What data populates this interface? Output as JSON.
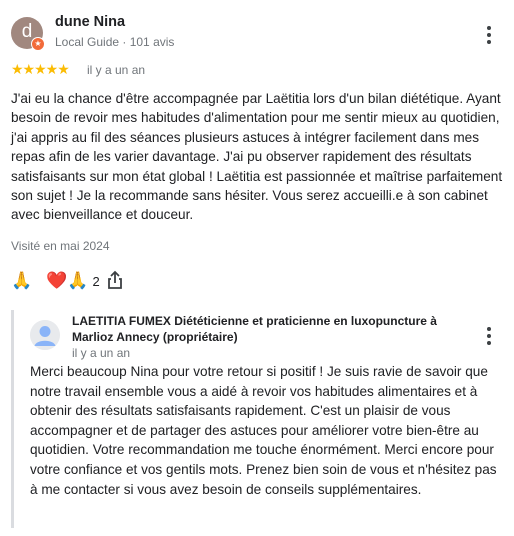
{
  "review": {
    "avatar_letter": "d",
    "author": "dune Nina",
    "meta": "Local Guide · 101 avis",
    "stars": "★★★★★",
    "rating": 5,
    "date": "il y a un an",
    "text": "J'ai eu la chance d'être accompagnée par Laëtitia lors d'un bilan diététique. Ayant besoin de revoir mes habitudes d'alimentation pour me sentir mieux au quotidien, j'ai appris au fil des séances plusieurs astuces à intégrer facilement dans mes repas afin de les varier davantage. J'ai pu observer rapidement des résultats satisfaisants sur mon état global ! Laëtitia est passionnée et maîtrise parfaitement son sujet ! Je la recommande sans hésiter. Vous serez accueilli.e à son cabinet avec bienveillance et douceur.",
    "visited": "Visité en mai 2024",
    "reactions": {
      "pray_emoji": "🙏",
      "group_emoji": "❤️🙏",
      "count": "2"
    }
  },
  "owner_reply": {
    "name": "LAETITIA FUMEX Diététicienne et praticienne en luxopuncture à Marlioz Annecy (propriétaire)",
    "date": "il y a un an",
    "text": "Merci beaucoup Nina pour votre retour si positif ! Je suis ravie de savoir que notre travail ensemble vous a aidé à revoir vos habitudes alimentaires et à obtenir des résultats satisfaisants rapidement. C'est un plaisir de vous accompagner et de partager des astuces pour améliorer votre bien-être au quotidien. Votre recommandation me touche énormément. Merci encore pour votre confiance et vos gentils mots. Prenez bien soin de vous et n'hésitez pas à me contacter si vous avez besoin de conseils supplémentaires."
  },
  "icons": {
    "menu": "more-vert-icon",
    "share": "share-icon",
    "owner_avatar": "person-avatar-icon",
    "local_guide_badge": "local-guide-badge-icon"
  },
  "colors": {
    "star": "#fbbc04",
    "avatar_bg": "#a1887f",
    "badge": "#f26b3a",
    "secondary_text": "#70757a",
    "reply_bar": "#dadce0"
  }
}
